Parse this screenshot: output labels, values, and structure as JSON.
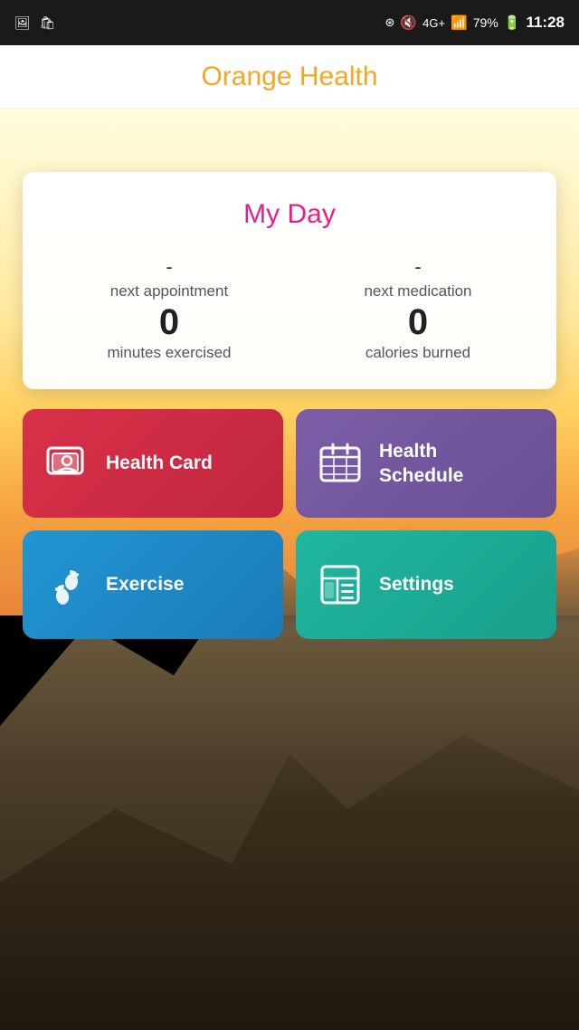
{
  "statusBar": {
    "time": "11:28",
    "battery": "79%",
    "signal": "4G+"
  },
  "header": {
    "title": "Orange Health",
    "titleColor": "#f5a623"
  },
  "myDay": {
    "title": "My Day",
    "nextAppointmentDash": "-",
    "nextAppointmentLabel": "next appointment",
    "nextMedicationDash": "-",
    "nextMedicationLabel": "next medication",
    "minutesExercised": "0",
    "minutesExercisedLabel": "minutes exercised",
    "caloriesBurned": "0",
    "caloriesBurnedLabel": "calories burned"
  },
  "actions": {
    "healthCard": "Health Card",
    "healthScheduleLine1": "Health",
    "healthScheduleLine2": "Schedule",
    "exercise": "Exercise",
    "settings": "Settings"
  }
}
